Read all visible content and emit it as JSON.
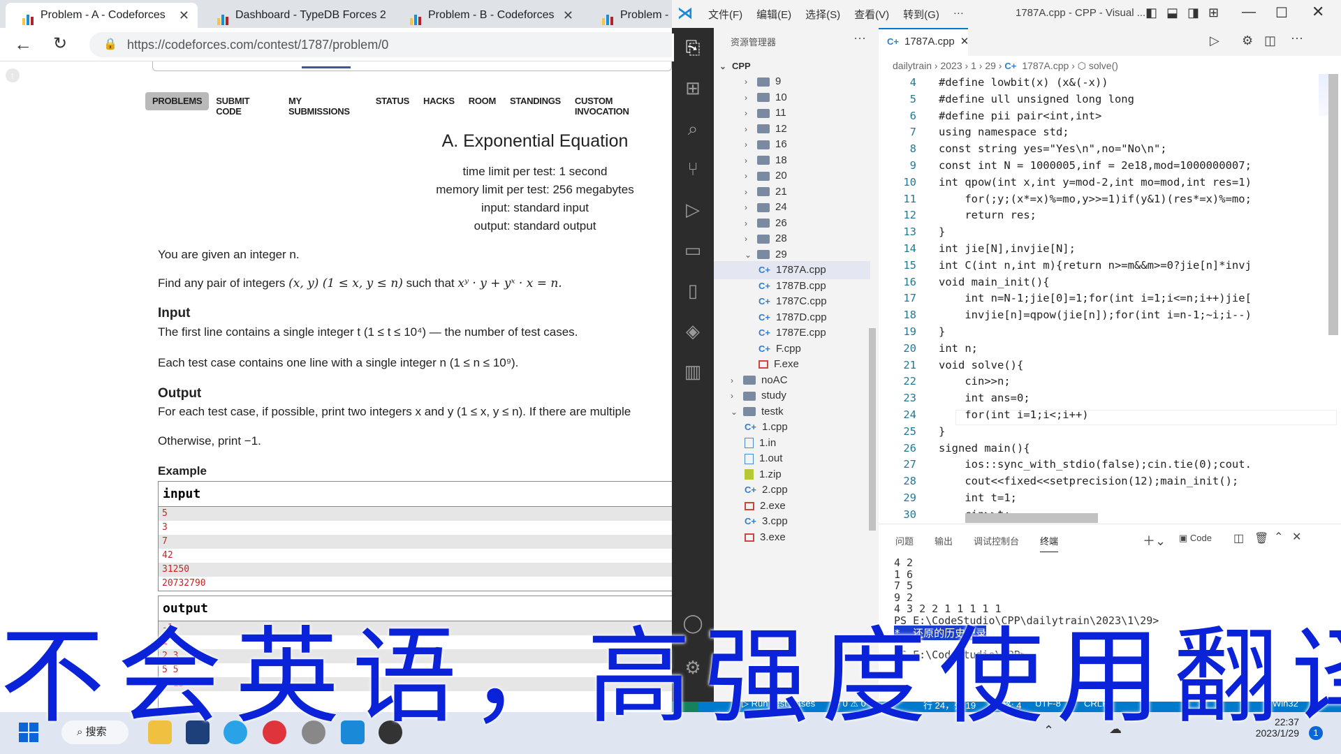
{
  "browser": {
    "tabs": [
      {
        "label": "Problem - A - Codeforces",
        "active": true
      },
      {
        "label": "Dashboard - TypeDB Forces 2",
        "active": false
      },
      {
        "label": "Problem - B - Codeforces",
        "active": false
      },
      {
        "label": "Problem - C",
        "active": false
      }
    ],
    "url": "https://codeforces.com/contest/1787/problem/0"
  },
  "cf": {
    "menu": [
      "PROBLEMS",
      "SUBMIT CODE",
      "MY SUBMISSIONS",
      "STATUS",
      "HACKS",
      "ROOM",
      "STANDINGS",
      "CUSTOM INVOCATION"
    ],
    "title": "A. Exponential Equation",
    "time_limit": "time limit per test: 1 second",
    "memory_limit": "memory limit per test: 256 megabytes",
    "input_type": "input: standard input",
    "output_type": "output: standard output",
    "stmt1": "You are given an integer n.",
    "stmt2a": "Find any pair of integers ",
    "stmt2math": "(x, y) (1 ≤ x, y ≤ n)",
    "stmt2b": " such that ",
    "stmt2eq": "xʸ · y + yˣ · x = n.",
    "input_heading": "Input",
    "input_text": "The first line contains a single integer t (1 ≤ t ≤ 10⁴) — the number of test cases.",
    "input_text2": "Each test case contains one line with a single integer n (1 ≤ n ≤ 10⁹).",
    "output_heading": "Output",
    "output_text": "For each test case, if possible, print two integers x and y (1 ≤ x, y ≤ n). If there are multiple",
    "output_text2": "Otherwise, print −1.",
    "example_heading": "Example",
    "input_label": "input",
    "input_lines": [
      "5",
      "3",
      "7",
      "42",
      "31250",
      "20732790"
    ],
    "output_label": "output",
    "output_lines": [
      "-1",
      "1",
      "2 3",
      "5 5",
      "3 13"
    ]
  },
  "vscode": {
    "menus": [
      "文件(F)",
      "编辑(E)",
      "选择(S)",
      "查看(V)",
      "转到(G)",
      "···"
    ],
    "window_title": "1787A.cpp - CPP - Visual ...",
    "explorer_title": "资源管理器",
    "root": "CPP",
    "tree": [
      {
        "label": "9",
        "kind": "folder",
        "indent": 1,
        "open": false
      },
      {
        "label": "10",
        "kind": "folder",
        "indent": 1,
        "open": false
      },
      {
        "label": "11",
        "kind": "folder",
        "indent": 1,
        "open": false
      },
      {
        "label": "12",
        "kind": "folder",
        "indent": 1,
        "open": false
      },
      {
        "label": "16",
        "kind": "folder",
        "indent": 1,
        "open": false
      },
      {
        "label": "18",
        "kind": "folder",
        "indent": 1,
        "open": false
      },
      {
        "label": "20",
        "kind": "folder",
        "indent": 1,
        "open": false
      },
      {
        "label": "21",
        "kind": "folder",
        "indent": 1,
        "open": false
      },
      {
        "label": "24",
        "kind": "folder",
        "indent": 1,
        "open": false
      },
      {
        "label": "26",
        "kind": "folder",
        "indent": 1,
        "open": false
      },
      {
        "label": "28",
        "kind": "folder",
        "indent": 1,
        "open": false
      },
      {
        "label": "29",
        "kind": "folder",
        "indent": 1,
        "open": true
      },
      {
        "label": "1787A.cpp",
        "kind": "cpp",
        "indent": 2,
        "selected": true
      },
      {
        "label": "1787B.cpp",
        "kind": "cpp",
        "indent": 2
      },
      {
        "label": "1787C.cpp",
        "kind": "cpp",
        "indent": 2
      },
      {
        "label": "1787D.cpp",
        "kind": "cpp",
        "indent": 2
      },
      {
        "label": "1787E.cpp",
        "kind": "cpp",
        "indent": 2
      },
      {
        "label": "F.cpp",
        "kind": "cpp",
        "indent": 2
      },
      {
        "label": "F.exe",
        "kind": "exe",
        "indent": 2
      },
      {
        "label": "noAC",
        "kind": "folder",
        "indent": 0,
        "open": false
      },
      {
        "label": "study",
        "kind": "folder",
        "indent": 0,
        "open": false
      },
      {
        "label": "testk",
        "kind": "folder",
        "indent": 0,
        "open": true
      },
      {
        "label": "1.cpp",
        "kind": "cpp",
        "indent": 1
      },
      {
        "label": "1.in",
        "kind": "file",
        "indent": 1
      },
      {
        "label": "1.out",
        "kind": "file",
        "indent": 1
      },
      {
        "label": "1.zip",
        "kind": "zip",
        "indent": 1
      },
      {
        "label": "2.cpp",
        "kind": "cpp",
        "indent": 1
      },
      {
        "label": "2.exe",
        "kind": "exe",
        "indent": 1
      },
      {
        "label": "3.cpp",
        "kind": "cpp",
        "indent": 1
      },
      {
        "label": "3.exe",
        "kind": "exe",
        "indent": 1
      }
    ],
    "editor_tab": "1787A.cpp",
    "breadcrumb": [
      "dailytrain",
      "2023",
      "1",
      "29",
      "1787A.cpp",
      "solve()"
    ],
    "code": [
      {
        "n": "4",
        "t": "#define lowbit(x) (x&(-x))"
      },
      {
        "n": "5",
        "t": "#define ull unsigned long long"
      },
      {
        "n": "6",
        "t": "#define pii pair<int,int>"
      },
      {
        "n": "7",
        "t": "using namespace std;"
      },
      {
        "n": "8",
        "t": "const string yes=\"Yes\\n\",no=\"No\\n\";"
      },
      {
        "n": "9",
        "t": "const int N = 1000005,inf = 2e18,mod=1000000007;"
      },
      {
        "n": "10",
        "t": "int qpow(int x,int y=mod-2,int mo=mod,int res=1)"
      },
      {
        "n": "11",
        "t": "    for(;y;(x*=x)%=mo,y>>=1)if(y&1)(res*=x)%=mo;"
      },
      {
        "n": "12",
        "t": "    return res;"
      },
      {
        "n": "13",
        "t": "}"
      },
      {
        "n": "14",
        "t": "int jie[N],invjie[N];"
      },
      {
        "n": "15",
        "t": "int C(int n,int m){return n>=m&&m>=0?jie[n]*invj"
      },
      {
        "n": "16",
        "t": "void main_init(){"
      },
      {
        "n": "17",
        "t": "    int n=N-1;jie[0]=1;for(int i=1;i<=n;i++)jie["
      },
      {
        "n": "18",
        "t": "    invjie[n]=qpow(jie[n]);for(int i=n-1;~i;i--)"
      },
      {
        "n": "19",
        "t": "}"
      },
      {
        "n": "20",
        "t": "int n;"
      },
      {
        "n": "21",
        "t": "void solve(){"
      },
      {
        "n": "22",
        "t": "    cin>>n;"
      },
      {
        "n": "23",
        "t": "    int ans=0;"
      },
      {
        "n": "24",
        "t": "    for(int i=1;i<;i++)"
      },
      {
        "n": "25",
        "t": "}"
      },
      {
        "n": "26",
        "t": "signed main(){"
      },
      {
        "n": "27",
        "t": "    ios::sync_with_stdio(false);cin.tie(0);cout."
      },
      {
        "n": "28",
        "t": "    cout<<fixed<<setprecision(12);main_init();"
      },
      {
        "n": "29",
        "t": "    int t=1;"
      },
      {
        "n": "30",
        "t": "    cin>>t;"
      }
    ],
    "panel_tabs": [
      "问题",
      "输出",
      "调试控制台",
      "终端"
    ],
    "panel_code_label": "Code",
    "terminal": [
      "4 2",
      "1 6",
      "7 5",
      "9 2",
      "4 3 2 2 1 1 1 1 1",
      "PS E:\\CodeStudio\\CPP\\dailytrain\\2023\\1\\29>",
      "*  还原的历史记录",
      "",
      "PS E:\\CodeStudio\\CPP>"
    ],
    "status": {
      "run": "Run Test Cases",
      "errors": "0",
      "warnings": "0",
      "position": "行 24，列 19",
      "spaces": "空格: 4",
      "encoding": "UTF-8",
      "eol": "CRLF",
      "os": "Win32"
    }
  },
  "taskbar": {
    "search_label": "搜索",
    "time": "22:37",
    "date": "2023/1/29"
  },
  "subtitle": "不会英语，高强度使用翻译",
  "colors": {
    "subtitle": "#0a23d8",
    "vscode_accent": "#007acc",
    "keyword": "#0000ff"
  }
}
